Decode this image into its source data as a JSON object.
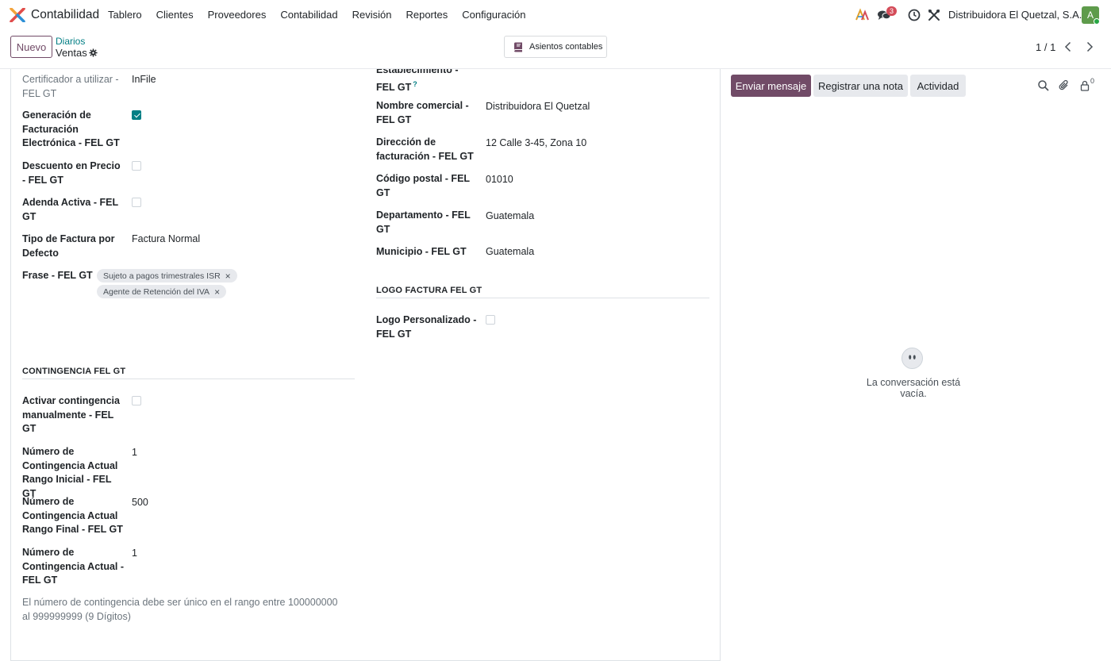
{
  "app": {
    "name": "Contabilidad"
  },
  "menu": [
    "Tablero",
    "Clientes",
    "Proveedores",
    "Contabilidad",
    "Revisión",
    "Reportes",
    "Configuración"
  ],
  "navbar": {
    "chat_count": "3",
    "company": "Distribuidora El Quetzal, S.A.",
    "avatar_letter": "A"
  },
  "control": {
    "new_label": "Nuevo",
    "breadcrumb_parent": "Diarios",
    "breadcrumb_current": "Ventas",
    "smart_button": "Asientos contables",
    "pager": "1 / 1"
  },
  "left": {
    "certificador_label": "Certificador a utilizar - FEL GT",
    "certificador_value": "InFile",
    "generacion_label": "Generación de Facturación Electrónica - FEL GT",
    "generacion_checked": true,
    "descuento_label": "Descuento en Precio - FEL GT",
    "descuento_checked": false,
    "adenda_label": "Adenda Activa - FEL GT",
    "adenda_checked": false,
    "tipo_label": "Tipo de Factura por Defecto",
    "tipo_value": "Factura Normal",
    "frase_label": "Frase - FEL GT",
    "frase_tags": [
      "Sujeto a pagos trimestrales ISR",
      "Agente de Retención del IVA"
    ]
  },
  "right": {
    "establecimiento_label": "Establecimiento - FEL GT",
    "nombre_label": "Nombre comercial - FEL GT",
    "nombre_value": "Distribuidora El Quetzal",
    "direccion_label": "Dirección de facturación - FEL GT",
    "direccion_value": "12 Calle 3-45, Zona 10",
    "postal_label": "Código postal - FEL GT",
    "postal_value": "01010",
    "departamento_label": "Departamento - FEL GT",
    "departamento_value": "Guatemala",
    "municipio_label": "Municipio - FEL GT",
    "municipio_value": "Guatemala",
    "logo_section": "LOGO FACTURA FEL GT",
    "logo_label": "Logo Personalizado - FEL GT",
    "logo_checked": false
  },
  "contingencia": {
    "section": "CONTINGENCIA FEL GT",
    "activar_label": "Activar contingencia manualmente - FEL GT",
    "activar_checked": false,
    "inicial_label": "Número de Contingencia Actual Rango Inicial - FEL GT",
    "inicial_value": "1",
    "final_label": "Número de Contingencia Actual Rango Final - FEL GT",
    "final_value": "500",
    "actual_label": "Número de Contingencia Actual - FEL GT",
    "actual_value": "1",
    "note": "El número de contingencia debe ser único en el rango entre 100000000 al 999999999 (9 Dígitos)"
  },
  "chatter": {
    "send": "Enviar mensaje",
    "note": "Registrar una nota",
    "activity": "Actividad",
    "followers": "0",
    "empty": "La conversación está vacía."
  },
  "colors": {
    "brand": "#714b67",
    "accent": "#017e84",
    "badge": "#d44c59"
  }
}
